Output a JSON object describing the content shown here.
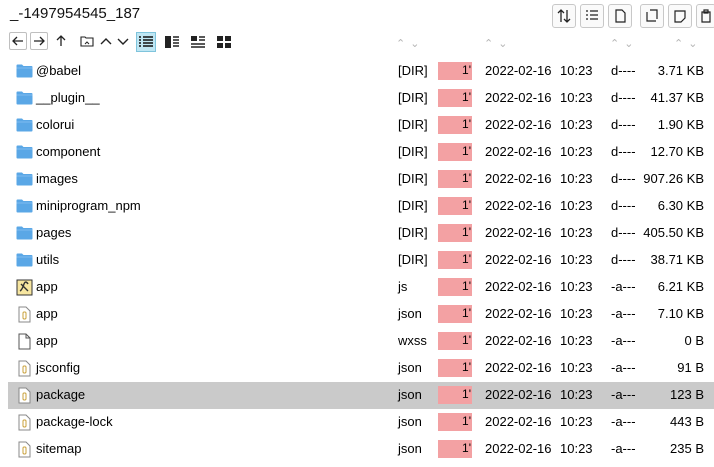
{
  "window": {
    "title": "_-1497954545_187"
  },
  "toolbar": {
    "right_buttons": [
      "sort-icon",
      "list-details-icon",
      "new-file-icon",
      "new-folder-icon",
      "rename-icon",
      "paste-icon"
    ],
    "nav": [
      "back-arrow-icon",
      "forward-arrow-icon",
      "up-arrow-icon",
      "folder-tree-icon"
    ],
    "views": [
      "detail-view-icon",
      "list-view-icon",
      "brief-view-icon",
      "thumbnail-view-icon"
    ]
  },
  "files": [
    {
      "name": "@babel",
      "ext": "[DIR]",
      "hl": "1'",
      "date": "2022-02-16",
      "time": "10:23",
      "attr": "d----",
      "size": "3.71 KB",
      "icon": "folder-icon"
    },
    {
      "name": "__plugin__",
      "ext": "[DIR]",
      "hl": "1'",
      "date": "2022-02-16",
      "time": "10:23",
      "attr": "d----",
      "size": "41.37 KB",
      "icon": "folder-icon"
    },
    {
      "name": "colorui",
      "ext": "[DIR]",
      "hl": "1'",
      "date": "2022-02-16",
      "time": "10:23",
      "attr": "d----",
      "size": "1.90 KB",
      "icon": "folder-icon"
    },
    {
      "name": "component",
      "ext": "[DIR]",
      "hl": "1'",
      "date": "2022-02-16",
      "time": "10:23",
      "attr": "d----",
      "size": "12.70 KB",
      "icon": "folder-icon"
    },
    {
      "name": "images",
      "ext": "[DIR]",
      "hl": "1'",
      "date": "2022-02-16",
      "time": "10:23",
      "attr": "d----",
      "size": "907.26 KB",
      "icon": "folder-icon"
    },
    {
      "name": "miniprogram_npm",
      "ext": "[DIR]",
      "hl": "1'",
      "date": "2022-02-16",
      "time": "10:23",
      "attr": "d----",
      "size": "6.30 KB",
      "icon": "folder-icon"
    },
    {
      "name": "pages",
      "ext": "[DIR]",
      "hl": "1'",
      "date": "2022-02-16",
      "time": "10:23",
      "attr": "d----",
      "size": "405.50 KB",
      "icon": "folder-icon"
    },
    {
      "name": "utils",
      "ext": "[DIR]",
      "hl": "1'",
      "date": "2022-02-16",
      "time": "10:23",
      "attr": "d----",
      "size": "38.71 KB",
      "icon": "folder-icon"
    },
    {
      "name": "app",
      "ext": "js",
      "hl": "1'",
      "date": "2022-02-16",
      "time": "10:23",
      "attr": "-a---",
      "size": "6.21 KB",
      "icon": "js-file-icon"
    },
    {
      "name": "app",
      "ext": "json",
      "hl": "1'",
      "date": "2022-02-16",
      "time": "10:23",
      "attr": "-a---",
      "size": "7.10 KB",
      "icon": "json-file-icon"
    },
    {
      "name": "app",
      "ext": "wxss",
      "hl": "1'",
      "date": "2022-02-16",
      "time": "10:23",
      "attr": "-a---",
      "size": "0 B",
      "icon": "blank-file-icon"
    },
    {
      "name": "jsconfig",
      "ext": "json",
      "hl": "1'",
      "date": "2022-02-16",
      "time": "10:23",
      "attr": "-a---",
      "size": "91 B",
      "icon": "json-file-icon"
    },
    {
      "name": "package",
      "ext": "json",
      "hl": "1'",
      "date": "2022-02-16",
      "time": "10:23",
      "attr": "-a---",
      "size": "123 B",
      "icon": "json-file-icon",
      "selected": true
    },
    {
      "name": "package-lock",
      "ext": "json",
      "hl": "1'",
      "date": "2022-02-16",
      "time": "10:23",
      "attr": "-a---",
      "size": "443 B",
      "icon": "json-file-icon"
    },
    {
      "name": "sitemap",
      "ext": "json",
      "hl": "1'",
      "date": "2022-02-16",
      "time": "10:23",
      "attr": "-a---",
      "size": "235 B",
      "icon": "json-file-icon"
    }
  ],
  "colors": {
    "highlight": "#f3a1a3",
    "folder": "#5aa7e6",
    "selected_row": "#cacaca",
    "active_view": "#bfe6f3"
  }
}
